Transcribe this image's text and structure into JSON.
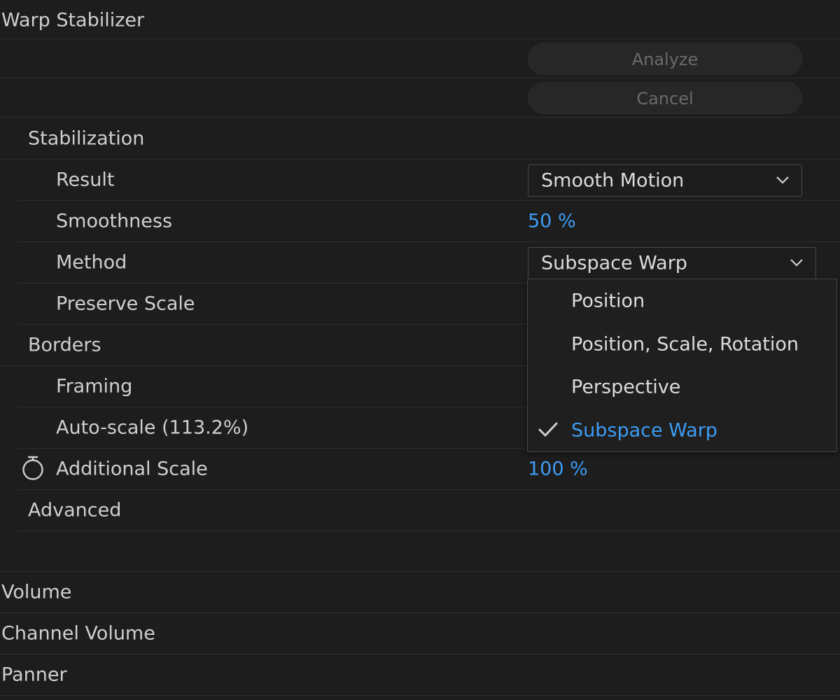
{
  "effect": {
    "title": "Warp Stabilizer",
    "analyze_label": "Analyze",
    "cancel_label": "Cancel"
  },
  "stabilization": {
    "section_label": "Stabilization",
    "result_label": "Result",
    "result_value": "Smooth Motion",
    "smoothness_label": "Smoothness",
    "smoothness_value": "50 %",
    "method_label": "Method",
    "method_value": "Subspace Warp",
    "preserve_scale_label": "Preserve Scale"
  },
  "method_dropdown": {
    "options": [
      "Position",
      "Position, Scale, Rotation",
      "Perspective",
      "Subspace Warp"
    ],
    "selected": "Subspace Warp"
  },
  "borders": {
    "section_label": "Borders",
    "framing_label": "Framing",
    "autoscale_label": "Auto-scale (113.2%)",
    "additional_scale_label": "Additional Scale",
    "additional_scale_value": "100 %"
  },
  "advanced": {
    "section_label": "Advanced"
  },
  "audio_effects": {
    "volume_label": "Volume",
    "channel_volume_label": "Channel Volume",
    "panner_label": "Panner"
  },
  "colors": {
    "background": "#1d1d1d",
    "accent_blue": "#3d9bf2",
    "text": "#cfcfcf",
    "disabled_text": "#6a6a6a"
  },
  "icons": {
    "chevron": "chevron-down-icon",
    "checkmark": "checkmark-icon",
    "stopwatch": "stopwatch-icon"
  }
}
